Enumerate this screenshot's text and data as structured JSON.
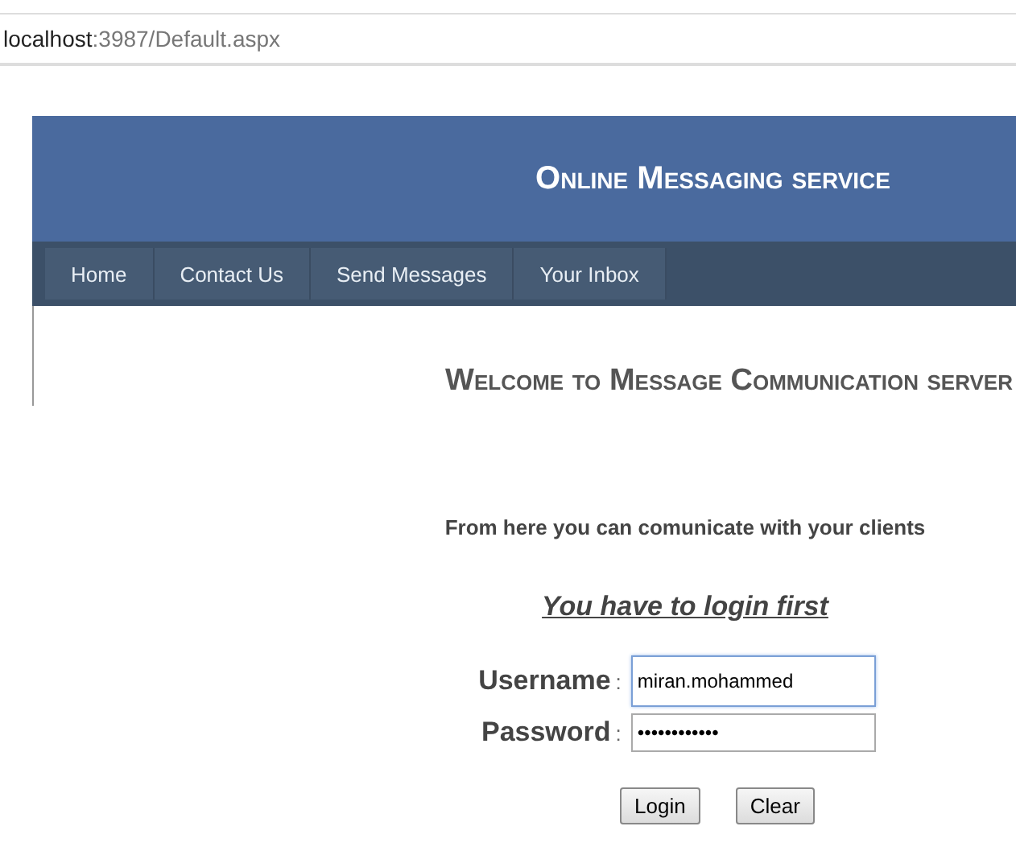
{
  "address_bar": {
    "host": "localhost",
    "path": ":3987/Default.aspx"
  },
  "header": {
    "title": "Online Messaging service"
  },
  "nav": [
    {
      "label": "Home"
    },
    {
      "label": "Contact Us"
    },
    {
      "label": "Send Messages"
    },
    {
      "label": "Your Inbox"
    }
  ],
  "content": {
    "heading": "Welcome to Message Communication server",
    "intro": "From here you can comunicate with your clients",
    "notice": "You have to login first"
  },
  "form": {
    "fields": [
      {
        "label": "Username",
        "separator": ":",
        "value": "miran.mohammed",
        "focused": true
      },
      {
        "label": "Password",
        "separator": ":",
        "value": "••••••••••••",
        "focused": false
      }
    ],
    "buttons": [
      "Login",
      "Clear"
    ]
  }
}
